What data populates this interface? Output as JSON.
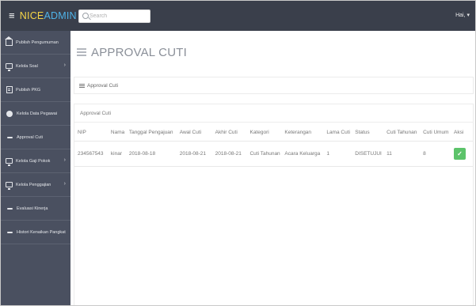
{
  "header": {
    "menu_icon": "≡",
    "brand_nice": "NICE",
    "brand_admin": "ADMIN",
    "search_placeholder": "Search",
    "user_menu": "Hai, ▾"
  },
  "sidebar": {
    "items": [
      {
        "label": "Publish Pengumuman",
        "icon": "home-icon",
        "has_chevron": false
      },
      {
        "label": "Kelola Soal",
        "icon": "monitor-icon",
        "has_chevron": true
      },
      {
        "label": "Publish PKG",
        "icon": "document-icon",
        "has_chevron": false
      },
      {
        "label": "Kelola Data Pegawai",
        "icon": "circle-icon",
        "has_chevron": false
      },
      {
        "label": "Approval Cuti",
        "icon": "dash-icon",
        "has_chevron": false
      },
      {
        "label": "Kelola Gaji Pokok",
        "icon": "monitor-icon",
        "has_chevron": true
      },
      {
        "label": "Kelola Penggajian",
        "icon": "monitor-icon",
        "has_chevron": true
      },
      {
        "label": "Evaluasi Kinerja",
        "icon": "dash-icon",
        "has_chevron": false
      },
      {
        "label": "Histori Kenaikan Pangkat",
        "icon": "dash-icon",
        "has_chevron": false
      }
    ],
    "chevron": "›"
  },
  "main": {
    "page_title": "APPROVAL CUTI",
    "breadcrumb": "Approval Cuti",
    "panel_title": "Approval Cuti",
    "table": {
      "columns": [
        "NIP",
        "Nama",
        "Tanggal Pengajuan",
        "Awal Cuti",
        "Akhir Cuti",
        "Kategori",
        "Keterangan",
        "Lama Cuti",
        "Status",
        "Cuti Tahunan",
        "Cuti Umum",
        "Aksi"
      ],
      "rows": [
        [
          "234567543",
          "kinar",
          "2018-08-18",
          "2018-08-21",
          "2018-08-21",
          "Cuti Tahunan",
          "Acara Keluarga",
          "1",
          "DISETUJUI",
          "11",
          "8",
          "✓"
        ]
      ]
    }
  },
  "colors": {
    "topbar": "#3a3f4b",
    "sidebar": "#4a5060",
    "brand_nice": "#f5d547",
    "brand_admin": "#4fb3e8",
    "approve_button": "#5cc36a"
  }
}
